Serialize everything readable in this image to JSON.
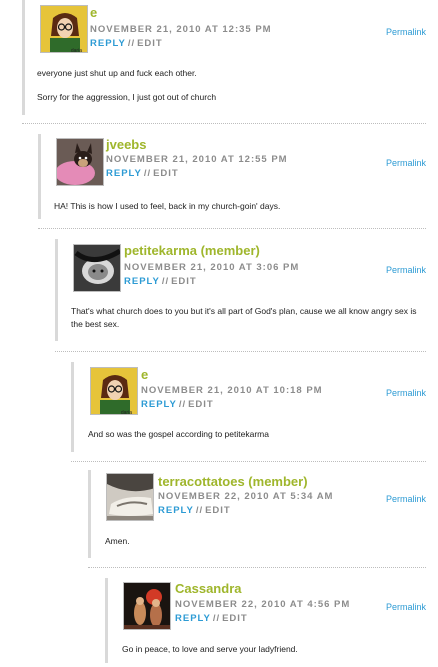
{
  "labels": {
    "reply": "REPLY",
    "separator": "//",
    "edit": "EDIT",
    "permalink": "Permalink"
  },
  "colors": {
    "author": "#9fb62c",
    "link": "#2d9bd4",
    "meta": "#8c8c8c"
  },
  "comments": [
    {
      "author": "e",
      "date": "NOVEMBER 21, 2010 AT 12:35 PM",
      "avatar_caption": "daria",
      "body": [
        "everyone just shut up and fuck each other.",
        "Sorry for the aggression, I just got out of church"
      ]
    },
    {
      "author": "jveebs",
      "date": "NOVEMBER 21, 2010 AT 12:55 PM",
      "body": [
        "HA! This is how I used to feel, back in my church-goin' days."
      ]
    },
    {
      "author": "petitekarma (member)",
      "date": "NOVEMBER 21, 2010 AT 3:06 PM",
      "body": [
        "That's what church does to you but it's all part of God's plan, cause we all know angry sex is the best sex."
      ]
    },
    {
      "author": "e",
      "date": "NOVEMBER 21, 2010 AT 10:18 PM",
      "avatar_caption": "daria",
      "body": [
        "And so was the gospel according to petitekarma"
      ]
    },
    {
      "author": "terracottatoes (member)",
      "date": "NOVEMBER 22, 2010 AT 5:34 AM",
      "body": [
        "Amen."
      ]
    },
    {
      "author": "Cassandra",
      "date": "NOVEMBER 22, 2010 AT 4:56 PM",
      "body": [
        "Go in peace, to love and serve your ladyfriend."
      ]
    }
  ]
}
